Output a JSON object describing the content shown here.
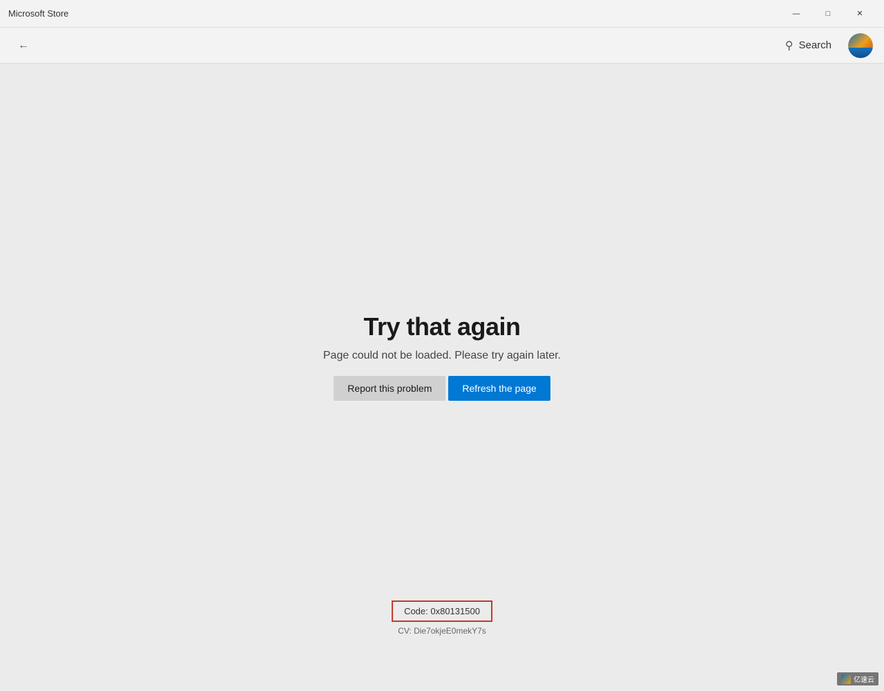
{
  "window": {
    "title": "Microsoft Store",
    "controls": {
      "minimize": "—",
      "maximize": "□",
      "close": "✕"
    }
  },
  "toolbar": {
    "back_label": "←",
    "search_label": "Search",
    "search_icon": "🔍"
  },
  "error": {
    "title": "Try that again",
    "subtitle": "Page could not be loaded. Please try again later.",
    "report_button": "Report this problem",
    "refresh_button": "Refresh the page",
    "code_label": "Code: 0x80131500",
    "cv_label": "CV: Die7okjeE0mekY7s"
  },
  "watermark": {
    "label": "亿速云"
  }
}
